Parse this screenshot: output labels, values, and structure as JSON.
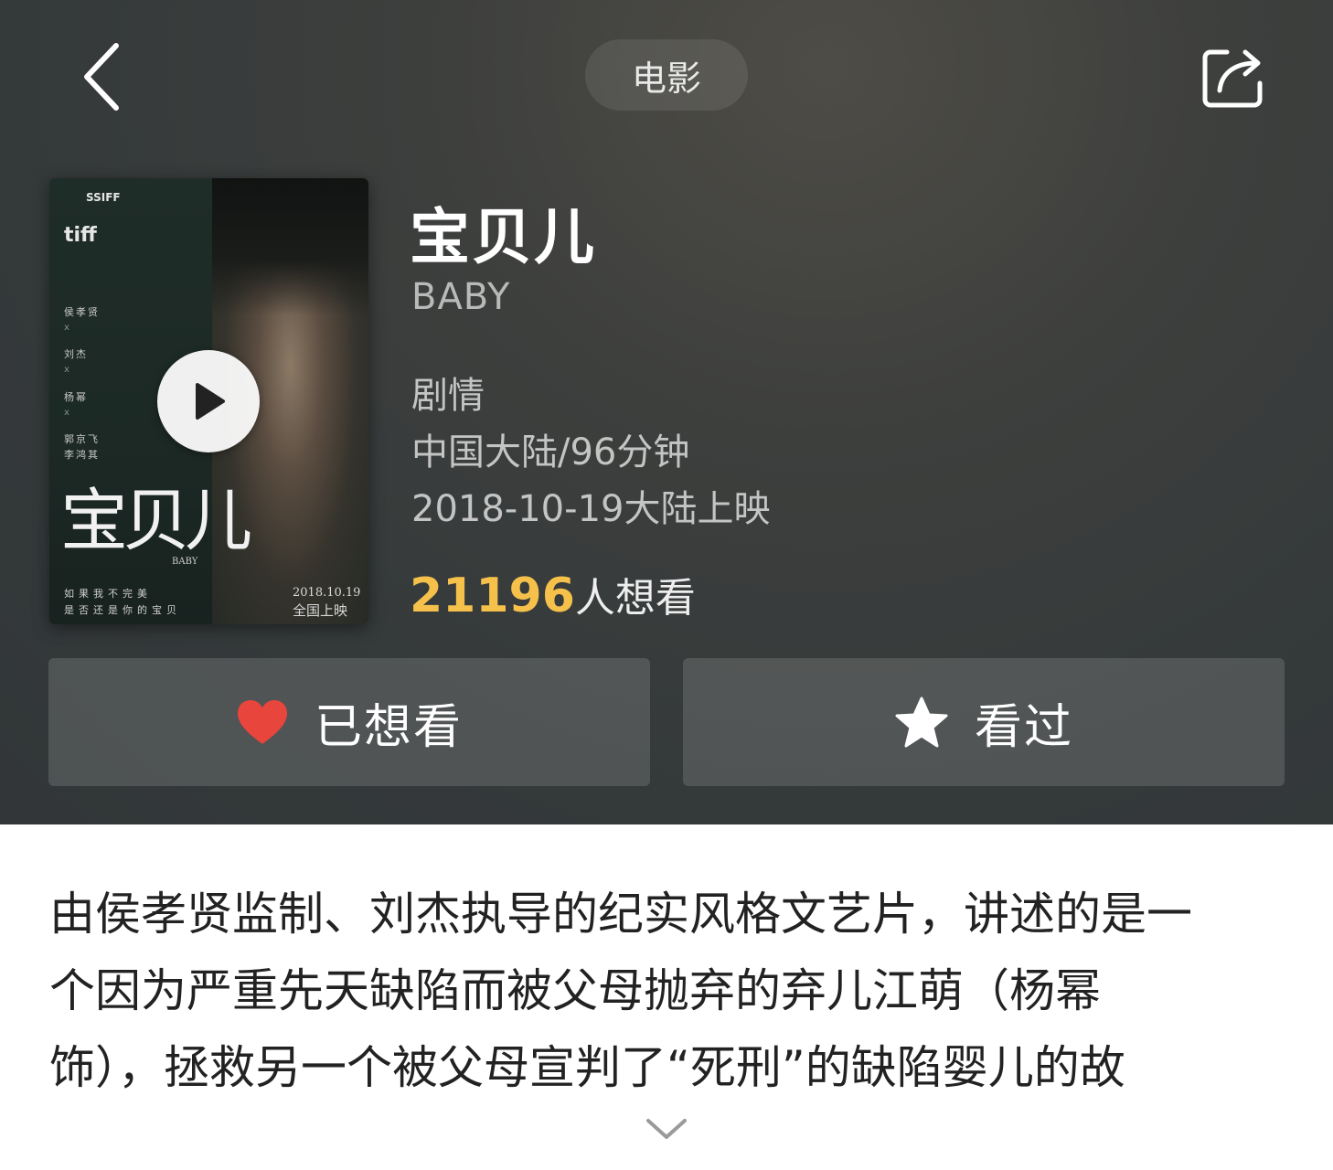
{
  "nav": {
    "back_icon": "chevron-left-icon",
    "category_label": "电影",
    "share_icon": "share-icon"
  },
  "poster": {
    "festival_1": "SSIFF",
    "festival_2": "tiff",
    "credits": [
      "侯孝贤",
      "刘杰",
      "杨幂",
      "郭京飞",
      "李鸿其"
    ],
    "title_art": "宝贝儿",
    "title_art_en": "BABY",
    "tagline_1": "如果我不完美",
    "tagline_2": "是否还是你的宝贝",
    "release_date_art": "2018.10.19",
    "release_region_art": "全国上映",
    "play_icon": "play-icon"
  },
  "movie": {
    "title": "宝贝儿",
    "title_en": "BABY",
    "genre": "剧情",
    "region_duration": "中国大陆/96分钟",
    "release": "2018-10-19大陆上映",
    "want_count": "21196",
    "want_suffix": "人想看"
  },
  "actions": {
    "wish_label": "已想看",
    "wish_icon": "heart-icon",
    "wish_icon_color": "#e8453c",
    "seen_label": "看过",
    "seen_icon": "star-icon"
  },
  "description": {
    "lines": [
      "由侯孝贤监制、刘杰执导的纪实风格文艺片，讲述的是一",
      "个因为严重先天缺陷而被父母抛弃的弃儿江萌（杨幂",
      "饰），拯救另一个被父母宣判了“死刑”的缺陷婴儿的故"
    ],
    "expand_icon": "chevron-down-icon"
  },
  "colors": {
    "accent_count": "#f6c14b",
    "header_bg": "#35393a"
  }
}
